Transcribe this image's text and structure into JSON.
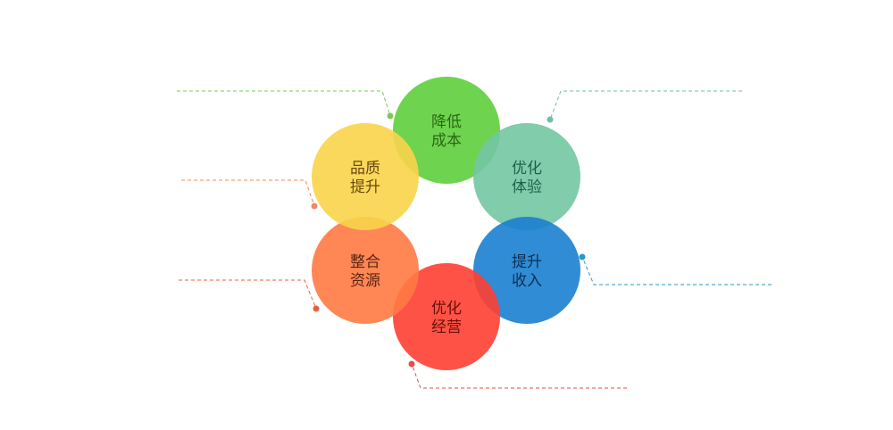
{
  "circles": [
    {
      "id": "reduce-cost",
      "line1": "降低",
      "line2": "成本",
      "fill": "#5ecf3c",
      "text_color": "#2b6614"
    },
    {
      "id": "optimize-experience",
      "line1": "优化",
      "line2": "体验",
      "fill": "#72c6a2",
      "text_color": "#1e6248"
    },
    {
      "id": "increase-revenue",
      "line1": "提升",
      "line2": "收入",
      "fill": "#1a7fd0",
      "text_color": "#0d2f52"
    },
    {
      "id": "optimize-operations",
      "line1": "优化",
      "line2": "经营",
      "fill": "#ff3f33",
      "text_color": "#6a0f0a"
    },
    {
      "id": "integrate-resources",
      "line1": "整合",
      "line2": "资源",
      "fill": "#ff7a44",
      "text_color": "#5a2410"
    },
    {
      "id": "improve-quality",
      "line1": "品质",
      "line2": "提升",
      "fill": "#f8d44a",
      "text_color": "#6b4a08"
    }
  ],
  "connectors": [
    {
      "for": "reduce-cost",
      "color": "#7ec85a"
    },
    {
      "for": "optimize-experience",
      "color": "#6fbfa2"
    },
    {
      "for": "increase-revenue",
      "color": "#2d96cf"
    },
    {
      "for": "optimize-operations",
      "color": "#e0504a"
    },
    {
      "for": "integrate-resources",
      "color": "#e8603a"
    },
    {
      "for": "improve-quality",
      "color": "#ee8a60"
    }
  ]
}
